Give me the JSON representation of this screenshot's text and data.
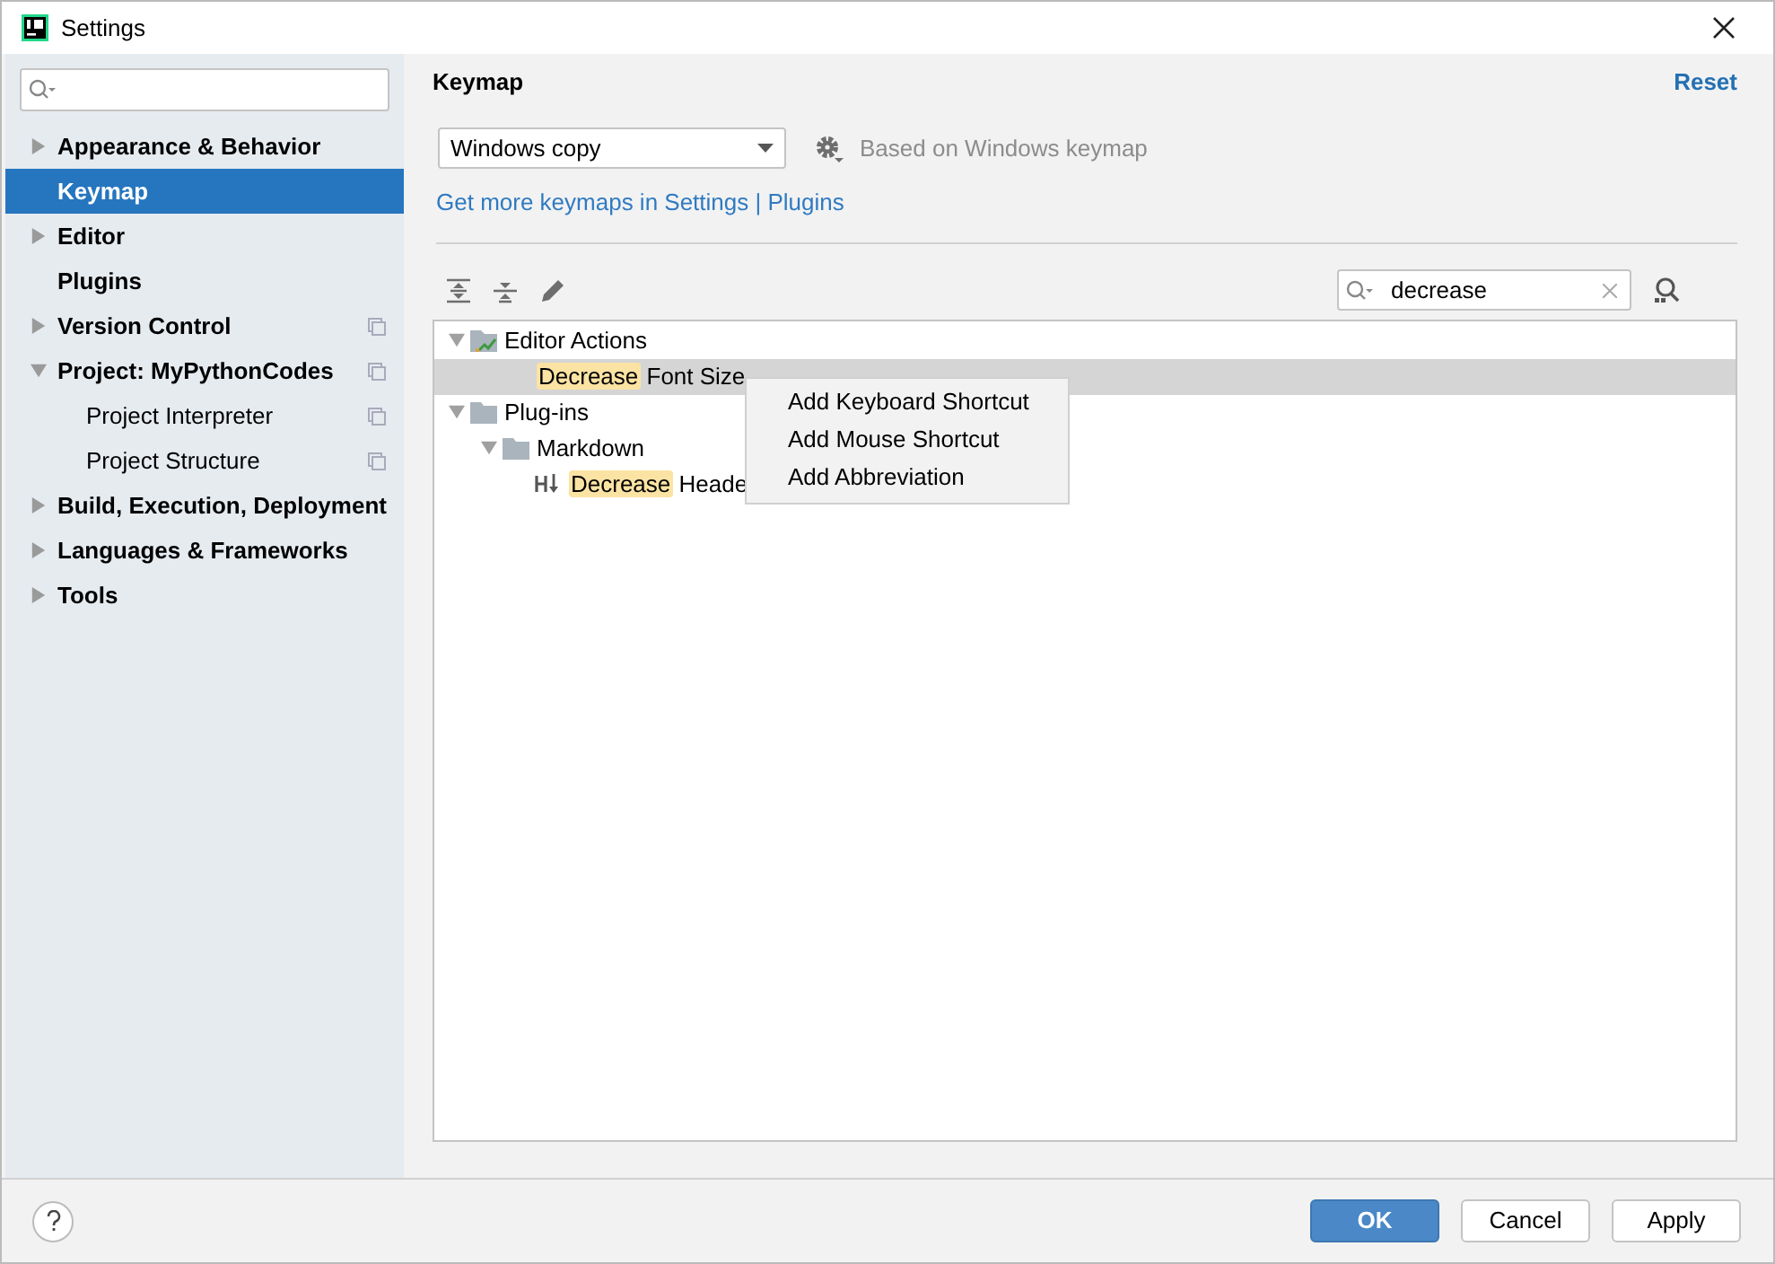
{
  "window": {
    "title": "Settings"
  },
  "sidebar": {
    "items": [
      {
        "label": "Appearance & Behavior",
        "selected": false,
        "expanded": false,
        "project_scoped": false
      },
      {
        "label": "Keymap",
        "selected": true,
        "project_scoped": false
      },
      {
        "label": "Editor",
        "selected": false,
        "expanded": false,
        "project_scoped": false
      },
      {
        "label": "Plugins",
        "selected": false,
        "project_scoped": false
      },
      {
        "label": "Version Control",
        "selected": false,
        "expanded": false,
        "project_scoped": true
      },
      {
        "label": "Project: MyPythonCodes",
        "selected": false,
        "expanded": true,
        "project_scoped": true,
        "children": [
          {
            "label": "Project Interpreter",
            "selected": false,
            "project_scoped": true
          },
          {
            "label": "Project Structure",
            "selected": false,
            "project_scoped": true
          }
        ]
      },
      {
        "label": "Build, Execution, Deployment",
        "selected": false,
        "expanded": false,
        "project_scoped": false
      },
      {
        "label": "Languages & Frameworks",
        "selected": false,
        "expanded": false,
        "project_scoped": false
      },
      {
        "label": "Tools",
        "selected": false,
        "expanded": false,
        "project_scoped": false
      }
    ]
  },
  "page": {
    "title": "Keymap",
    "reset": "Reset",
    "keymap": "Windows copy",
    "based_on": "Based on Windows keymap",
    "link": "Get more keymaps in Settings | Plugins",
    "search": {
      "value": "decrease"
    },
    "tree": [
      {
        "kind": "action-group",
        "label": "Editor Actions",
        "expanded": true,
        "selected": false,
        "children": [
          {
            "kind": "action",
            "match": "Decrease",
            "label": " Font Size",
            "selected": true
          }
        ]
      },
      {
        "kind": "folder",
        "label": "Plug-ins",
        "expanded": true,
        "selected": false,
        "children": [
          {
            "kind": "folder",
            "label": "Markdown",
            "expanded": true,
            "selected": false,
            "children": [
              {
                "kind": "markdown-action",
                "match": "Decrease",
                "label": " Heade",
                "selected": false
              }
            ]
          }
        ]
      }
    ],
    "context_menu": [
      "Add Keyboard Shortcut",
      "Add Mouse Shortcut",
      "Add Abbreviation"
    ]
  },
  "buttons": [
    {
      "label": "OK",
      "primary": true
    },
    {
      "label": "Cancel",
      "primary": false
    },
    {
      "label": "Apply",
      "primary": false
    }
  ]
}
